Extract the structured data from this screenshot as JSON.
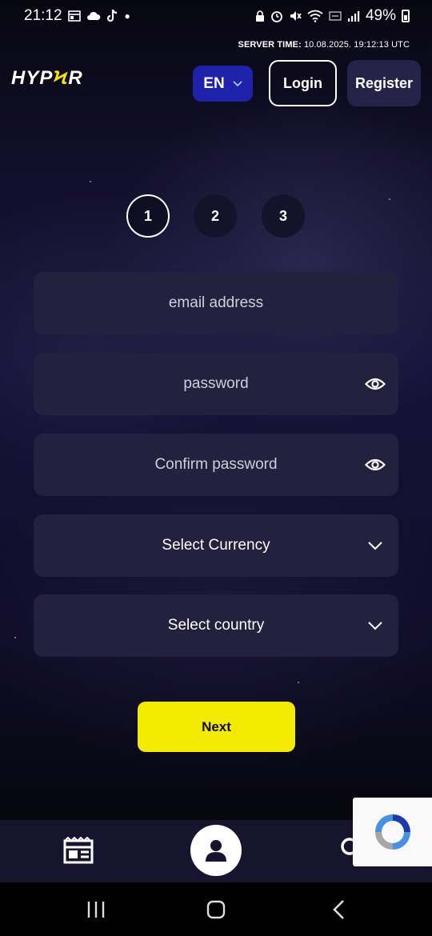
{
  "status_bar": {
    "time": "21:12",
    "battery": "49%"
  },
  "server_time": {
    "label": "SERVER TIME:",
    "value": "10.08.2025. 19:12:13 UTC"
  },
  "header": {
    "logo_text_before": "HYP",
    "logo_text_bolt": "Ϟ",
    "logo_text_after": "R",
    "language": "EN",
    "login_label": "Login",
    "register_label": "Register"
  },
  "steps": [
    "1",
    "2",
    "3"
  ],
  "form": {
    "email_placeholder": "email address",
    "password_placeholder": "password",
    "confirm_password_placeholder": "Confirm password",
    "currency_select": "Select Currency",
    "country_select": "Select country",
    "next_label": "Next"
  },
  "colors": {
    "accent_yellow": "#f2ea00",
    "lang_blue": "#1e22a8",
    "field_bg": "#24213f",
    "nav_bg": "#17152e"
  },
  "icons": {
    "eye": "eye-icon",
    "chevron": "chevron-down-icon",
    "news": "newspaper-icon",
    "profile": "user-icon",
    "search": "search-icon"
  }
}
